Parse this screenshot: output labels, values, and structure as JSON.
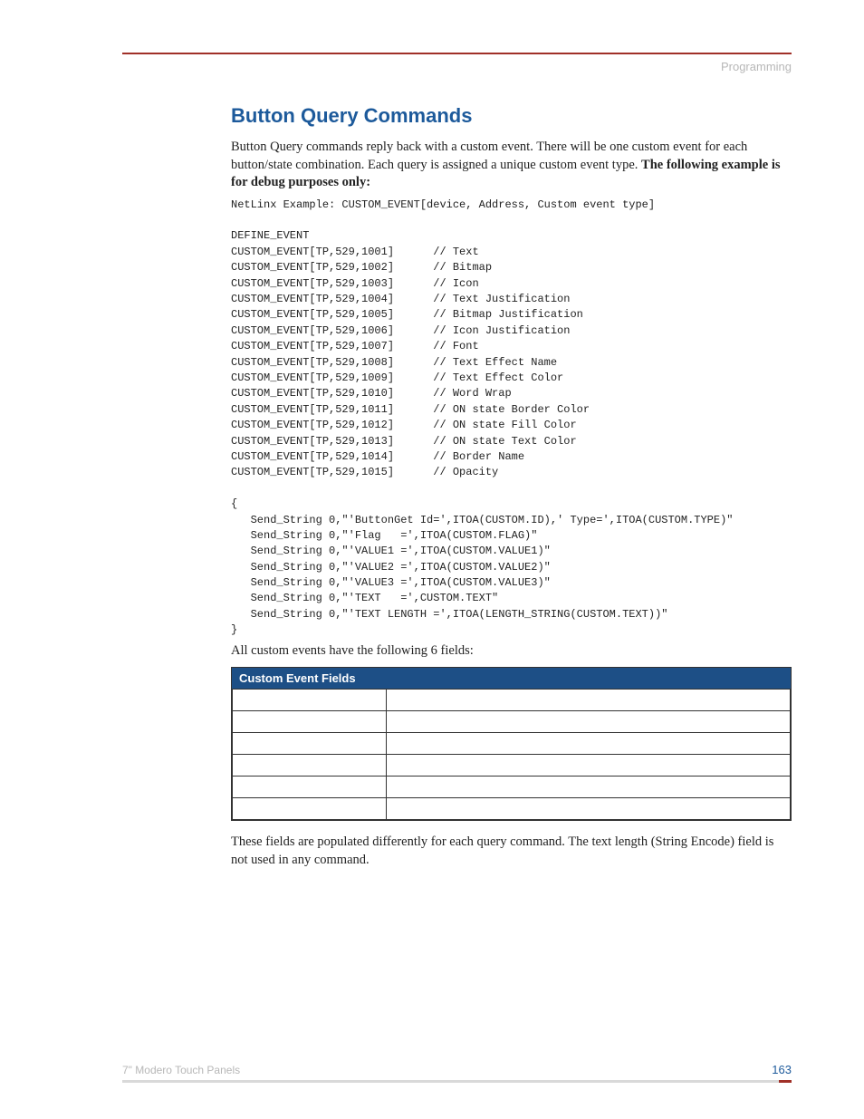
{
  "header": {
    "section": "Programming"
  },
  "title": "Button Query Commands",
  "intro_part1": "Button Query commands reply back with a custom event. There will be one custom event for each button/state combination. Each query is assigned a unique custom event type. ",
  "intro_bold": "The following example is for debug purposes only:",
  "code": "NetLinx Example: CUSTOM_EVENT[device, Address, Custom event type]\n\nDEFINE_EVENT\nCUSTOM_EVENT[TP,529,1001]      // Text\nCUSTOM_EVENT[TP,529,1002]      // Bitmap\nCUSTOM_EVENT[TP,529,1003]      // Icon\nCUSTOM_EVENT[TP,529,1004]      // Text Justification\nCUSTOM_EVENT[TP,529,1005]      // Bitmap Justification\nCUSTOM_EVENT[TP,529,1006]      // Icon Justification\nCUSTOM_EVENT[TP,529,1007]      // Font\nCUSTOM_EVENT[TP,529,1008]      // Text Effect Name\nCUSTOM_EVENT[TP,529,1009]      // Text Effect Color\nCUSTOM_EVENT[TP,529,1010]      // Word Wrap\nCUSTOM_EVENT[TP,529,1011]      // ON state Border Color\nCUSTOM_EVENT[TP,529,1012]      // ON state Fill Color\nCUSTOM_EVENT[TP,529,1013]      // ON state Text Color\nCUSTOM_EVENT[TP,529,1014]      // Border Name\nCUSTOM_EVENT[TP,529,1015]      // Opacity\n\n{\n   Send_String 0,\"'ButtonGet Id=',ITOA(CUSTOM.ID),' Type=',ITOA(CUSTOM.TYPE)\"\n   Send_String 0,\"'Flag   =',ITOA(CUSTOM.FLAG)\"\n   Send_String 0,\"'VALUE1 =',ITOA(CUSTOM.VALUE1)\"\n   Send_String 0,\"'VALUE2 =',ITOA(CUSTOM.VALUE2)\"\n   Send_String 0,\"'VALUE3 =',ITOA(CUSTOM.VALUE3)\"\n   Send_String 0,\"'TEXT   =',CUSTOM.TEXT\"\n   Send_String 0,\"'TEXT LENGTH =',ITOA(LENGTH_STRING(CUSTOM.TEXT))\"\n}",
  "after_code": "All custom events have the following 6 fields:",
  "table": {
    "title": "Custom Event Fields",
    "rows": [
      [
        "",
        ""
      ],
      [
        "",
        ""
      ],
      [
        "",
        ""
      ],
      [
        "",
        ""
      ],
      [
        "",
        ""
      ],
      [
        "",
        ""
      ]
    ]
  },
  "closing": "These fields are populated differently for each query command. The text length (String Encode) field is not used in any command.",
  "footer": {
    "product": "7\" Modero Touch Panels",
    "page": "163"
  }
}
